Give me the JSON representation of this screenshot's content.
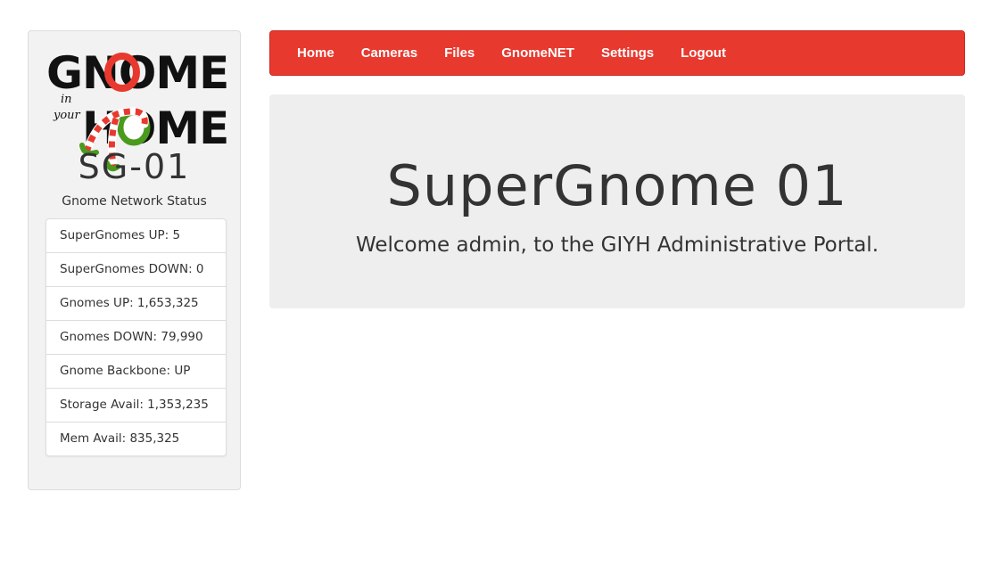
{
  "sidebar": {
    "logo": {
      "line1": "GNOME",
      "small1": "in",
      "small2": "your",
      "line2": "HOME"
    },
    "node_id": "SG-01",
    "status_title": "Gnome Network Status",
    "status_items": [
      "SuperGnomes UP: 5",
      "SuperGnomes DOWN: 0",
      "Gnomes UP: 1,653,325",
      "Gnomes DOWN: 79,990",
      "Gnome Backbone: UP",
      "Storage Avail: 1,353,235",
      "Mem Avail: 835,325"
    ]
  },
  "nav": {
    "items": [
      "Home",
      "Cameras",
      "Files",
      "GnomeNET",
      "Settings",
      "Logout"
    ]
  },
  "main": {
    "title": "SuperGnome 01",
    "subtitle": "Welcome admin, to the GIYH Administrative Portal."
  },
  "colors": {
    "nav_background": "#e8392f",
    "logo_red": "#e8392f",
    "logo_green": "#4a9a1e",
    "panel_background": "#eeeeee"
  }
}
